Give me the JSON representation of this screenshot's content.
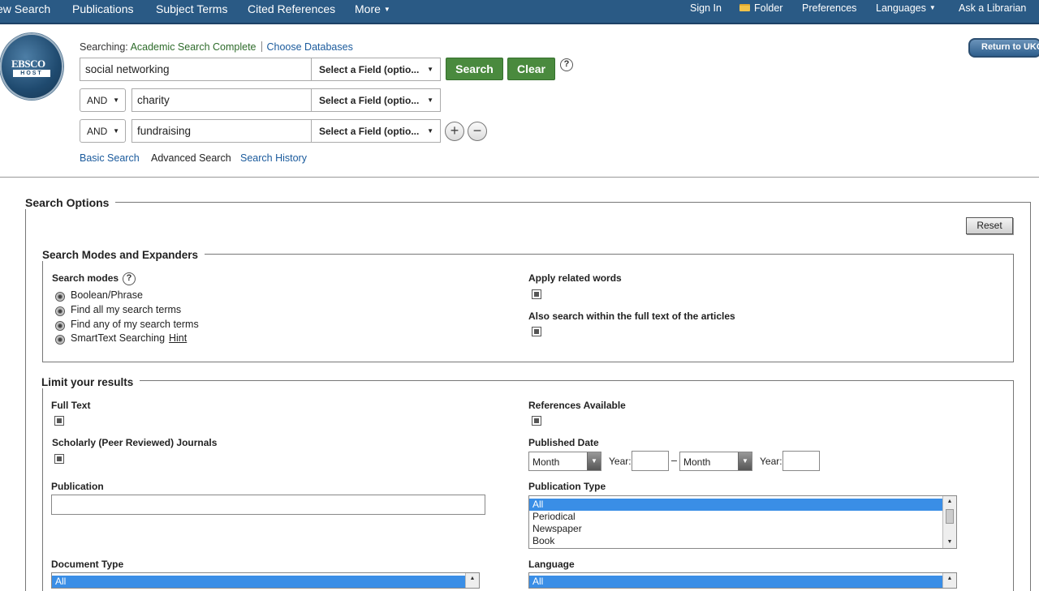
{
  "nav": {
    "left_items": [
      "ew Search",
      "Publications",
      "Subject Terms",
      "Cited References",
      "More"
    ],
    "right_items": [
      "Sign In",
      "Folder",
      "Preferences",
      "Languages",
      "Ask a Librarian"
    ]
  },
  "logo": {
    "line1": "EBSCO",
    "line2": "HOST"
  },
  "search": {
    "searching_label": "Searching:",
    "database": "Academic Search Complete",
    "choose_db": "Choose Databases",
    "rows": [
      {
        "operator": "",
        "term": "social networking",
        "field": "Select a Field (optio..."
      },
      {
        "operator": "AND",
        "term": "charity",
        "field": "Select a Field (optio..."
      },
      {
        "operator": "AND",
        "term": "fundraising",
        "field": "Select a Field (optio..."
      }
    ],
    "search_button": "Search",
    "clear_button": "Clear",
    "help": "?",
    "add": "+",
    "remove": "−",
    "links": {
      "basic": "Basic Search",
      "advanced": "Advanced Search",
      "history": "Search History"
    },
    "return_button": "Return to UKC"
  },
  "options": {
    "title": "Search Options",
    "reset": "Reset",
    "modes_title": "Search Modes and Expanders",
    "modes_label": "Search modes",
    "modes": [
      "Boolean/Phrase",
      "Find all my search terms",
      "Find any of my search terms",
      "SmartText Searching"
    ],
    "hint": "Hint",
    "apply_related": "Apply related words",
    "also_fulltext": "Also search within the full text of the articles"
  },
  "limits": {
    "title": "Limit your results",
    "full_text": "Full Text",
    "references_available": "References Available",
    "scholarly": "Scholarly (Peer Reviewed) Journals",
    "published_date": "Published Date",
    "month": "Month",
    "year_label": "Year:",
    "dash": "–",
    "publication": "Publication",
    "publication_type": "Publication Type",
    "publication_type_options": [
      "All",
      "Periodical",
      "Newspaper",
      "Book"
    ],
    "document_type": "Document Type",
    "document_type_options": [
      "All"
    ],
    "language": "Language",
    "language_options": [
      "All"
    ]
  }
}
